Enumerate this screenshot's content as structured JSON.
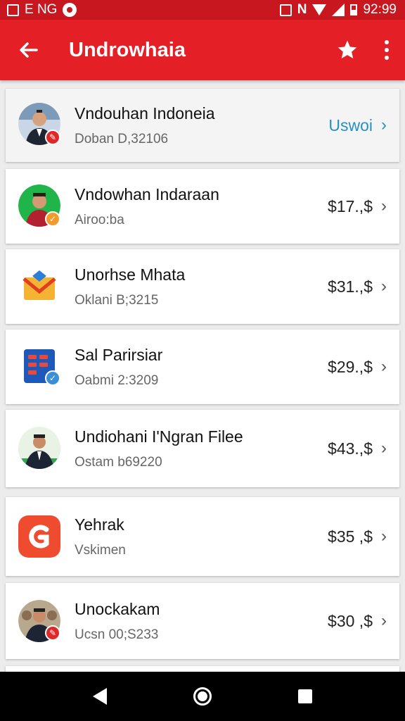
{
  "status_bar": {
    "left_text": "E NG",
    "time": "92:99"
  },
  "app_bar": {
    "title": "Undrowhaia",
    "back_icon": "arrow-back-icon",
    "star_icon": "star-icon",
    "more_icon": "more-vert-icon"
  },
  "items": [
    {
      "name": "Vndouhan Indoneia",
      "sub": "Doban D,32106",
      "value": "Uswoi",
      "is_link": true,
      "avatar": "photo",
      "badge_color": "#e02828"
    },
    {
      "name": "Vndowhan Indaraan",
      "sub": "Airoo:ba",
      "value": "$17.,$",
      "is_link": false,
      "avatar": "photo-green",
      "badge_color": "#f29a2e"
    },
    {
      "name": "Unorhse Mhata",
      "sub": "Oklani B;3215",
      "value": "$31.,$",
      "is_link": false,
      "avatar": "mail",
      "badge_color": ""
    },
    {
      "name": "Sal Parirsiar",
      "sub": "Oabmi 2:3209",
      "value": "$29.,$",
      "is_link": false,
      "avatar": "calendar",
      "badge_color": "#3b8fd9"
    },
    {
      "name": "Undiohani I'Ngran Filee",
      "sub": "Ostam b69220",
      "value": "$43.,$",
      "is_link": false,
      "avatar": "photo-suit",
      "badge_color": ""
    },
    {
      "name": "Yehrak",
      "sub": "Vskimen",
      "value": "$35 ,$",
      "is_link": false,
      "avatar": "app-g",
      "badge_color": ""
    },
    {
      "name": "Unockakam",
      "sub": "Ucsn 00;S233",
      "value": "$30 ,$",
      "is_link": false,
      "avatar": "photo-crowd",
      "badge_color": "#e02828"
    }
  ],
  "nav_bar": {
    "back": "nav-back-icon",
    "home": "nav-home-icon",
    "recent": "nav-recent-icon"
  }
}
